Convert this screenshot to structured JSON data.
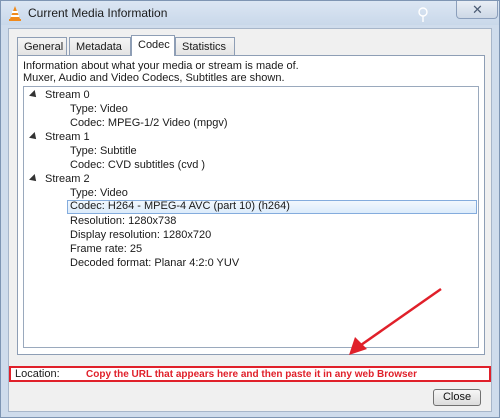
{
  "window": {
    "title": "Current Media Information",
    "close_glyph": "✕"
  },
  "tabs": [
    {
      "label": "General",
      "active": false
    },
    {
      "label": "Metadata",
      "active": false
    },
    {
      "label": "Codec",
      "active": true
    },
    {
      "label": "Statistics",
      "active": false
    }
  ],
  "codec": {
    "info_line1": "Information about what your media or stream is made of.",
    "info_line2": "Muxer, Audio and Video Codecs, Subtitles are shown.",
    "streams": [
      {
        "name": "Stream 0",
        "details": [
          "Type: Video",
          "Codec: MPEG-1/2 Video (mpgv)"
        ]
      },
      {
        "name": "Stream 1",
        "details": [
          "Type: Subtitle",
          "Codec: CVD subtitles (cvd )"
        ]
      },
      {
        "name": "Stream 2",
        "details": [
          "Type: Video",
          "Codec: H264 - MPEG-4 AVC (part 10) (h264)",
          "Resolution: 1280x738",
          "Display resolution: 1280x720",
          "Frame rate: 25",
          "Decoded format: Planar 4:2:0 YUV"
        ]
      }
    ]
  },
  "location": {
    "label": "Location:",
    "value": "",
    "annotation": "Copy the URL that appears here and then paste it in any web Browser"
  },
  "buttons": {
    "close_label": "Close"
  },
  "colors": {
    "highlight_red": "#e0202a",
    "selection": "#dcecfb"
  }
}
